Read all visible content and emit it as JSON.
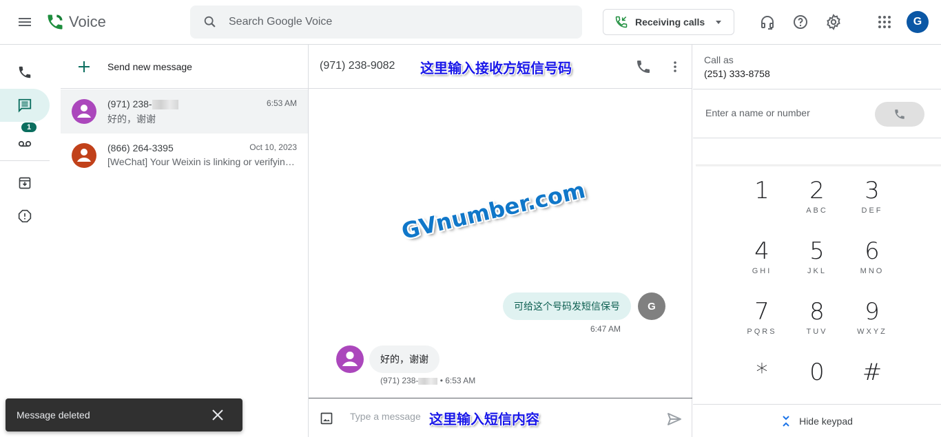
{
  "header": {
    "app_name": "Voice",
    "search_placeholder": "Search Google Voice",
    "receiving_label": "Receiving calls",
    "account_initial": "G"
  },
  "nav": {
    "voicemail_badge": "1"
  },
  "list": {
    "send_new_label": "Send new message",
    "conversations": [
      {
        "name": "(971) 238-",
        "time": "6:53 AM",
        "preview": "好的，谢谢",
        "avatar_color": "#ab47bc",
        "active": true
      },
      {
        "name": "(866) 264-3395",
        "time": "Oct 10, 2023",
        "preview": "[WeChat] Your Weixin is linking or verifying this phone number",
        "avatar_color": "#c1411a",
        "active": false
      }
    ]
  },
  "chat": {
    "recipient": "(971) 238-9082",
    "annotation_top": "这里输入接收方短信号码",
    "watermark": "GVnumber.com",
    "messages": [
      {
        "direction": "out",
        "text": "可给这个号码发短信保号",
        "time": "6:47 AM",
        "sender_initial": "G"
      },
      {
        "direction": "in",
        "text": "好的，谢谢",
        "meta_prefix": "(971) 238-",
        "meta_time": "• 6:53 AM"
      }
    ],
    "composer_placeholder": "Type a message",
    "annotation_bottom": "这里输入短信内容"
  },
  "dialer": {
    "call_as_label": "Call as",
    "call_as_number": "(251) 333-8758",
    "input_placeholder": "Enter a name or number",
    "keys": [
      {
        "digit": "1",
        "letters": ""
      },
      {
        "digit": "2",
        "letters": "ABC"
      },
      {
        "digit": "3",
        "letters": "DEF"
      },
      {
        "digit": "4",
        "letters": "GHI"
      },
      {
        "digit": "5",
        "letters": "JKL"
      },
      {
        "digit": "6",
        "letters": "MNO"
      },
      {
        "digit": "7",
        "letters": "PQRS"
      },
      {
        "digit": "8",
        "letters": "TUV"
      },
      {
        "digit": "9",
        "letters": "WXYZ"
      },
      {
        "digit": "*",
        "letters": ""
      },
      {
        "digit": "0",
        "letters": ""
      },
      {
        "digit": "#",
        "letters": ""
      }
    ],
    "hide_keypad_label": "Hide keypad"
  },
  "snackbar": {
    "text": "Message deleted"
  },
  "colors": {
    "accent_teal": "#0b6e5f",
    "active_nav_bg": "#e0f2f1",
    "account_blue": "#0b57a5",
    "annotation_blue": "#1a18e8",
    "watermark_blue": "#1077c9"
  }
}
